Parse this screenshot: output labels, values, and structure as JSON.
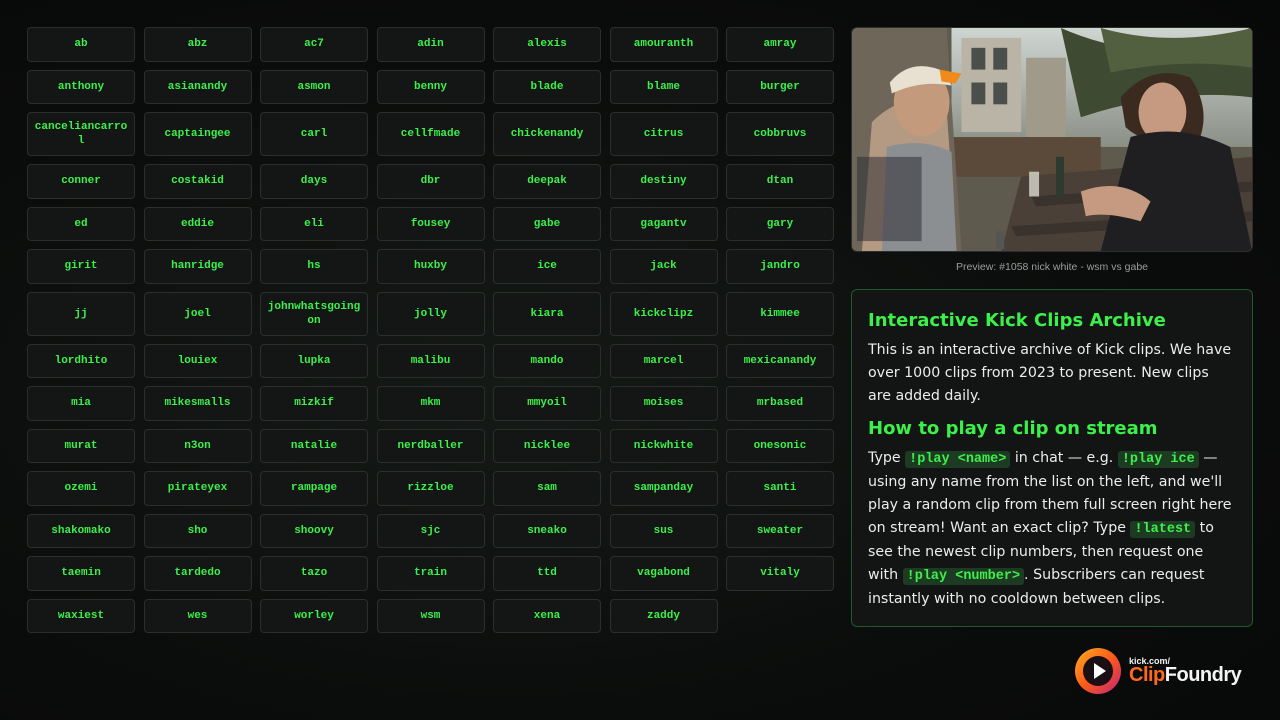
{
  "names": [
    "ab",
    "abz",
    "ac7",
    "adin",
    "alexis",
    "amouranth",
    "amray",
    "anthony",
    "asianandy",
    "asmon",
    "benny",
    "blade",
    "blame",
    "burger",
    "canceliancarrol",
    "captaingee",
    "carl",
    "cellfmade",
    "chickenandy",
    "citrus",
    "cobbruvs",
    "conner",
    "costakid",
    "days",
    "dbr",
    "deepak",
    "destiny",
    "dtan",
    "ed",
    "eddie",
    "eli",
    "fousey",
    "gabe",
    "gagantv",
    "gary",
    "girit",
    "hanridge",
    "hs",
    "huxby",
    "ice",
    "jack",
    "jandro",
    "jj",
    "joel",
    "johnwhatsgoingon",
    "jolly",
    "kiara",
    "kickclipz",
    "kimmee",
    "lordhito",
    "louiex",
    "lupka",
    "malibu",
    "mando",
    "marcel",
    "mexicanandy",
    "mia",
    "mikesmalls",
    "mizkif",
    "mkm",
    "mmyoil",
    "moises",
    "mrbased",
    "murat",
    "n3on",
    "natalie",
    "nerdballer",
    "nicklee",
    "nickwhite",
    "onesonic",
    "ozemi",
    "pirateyex",
    "rampage",
    "rizzloe",
    "sam",
    "sampanday",
    "santi",
    "shakomako",
    "sho",
    "shoovy",
    "sjc",
    "sneako",
    "sus",
    "sweater",
    "taemin",
    "tardedo",
    "tazo",
    "train",
    "ttd",
    "vagabond",
    "vitaly",
    "waxiest",
    "wes",
    "worley",
    "wsm",
    "xena",
    "zaddy"
  ],
  "tall_rows": [
    2,
    6
  ],
  "preview": {
    "caption": "Preview: #1058 nick white - wsm vs gabe"
  },
  "info": {
    "title": "Interactive Kick Clips Archive",
    "intro": "This is an interactive archive of Kick clips. We have over 1000 clips from 2023 to present. New clips are added daily.",
    "howto_title": "How to play a clip on stream",
    "p1": "Type ",
    "cmd1": "!play <name>",
    "p2": " in chat — e.g. ",
    "cmd2": "!play ice",
    "p3": " — using any name from the list on the left, and we'll play a random clip from them full screen right here on stream! Want an exact clip? Type ",
    "cmd3": "!latest",
    "p4": " to see the newest clip numbers, then request one with ",
    "cmd4": "!play <number>",
    "p5": ". Subscribers can request instantly with no cooldown between clips."
  },
  "logo": {
    "small": "kick.com/",
    "word1": "Clip",
    "word2": "Foundry"
  },
  "colors": {
    "accent": "#3cf04a",
    "logo_orange": "#ff6a1a"
  }
}
